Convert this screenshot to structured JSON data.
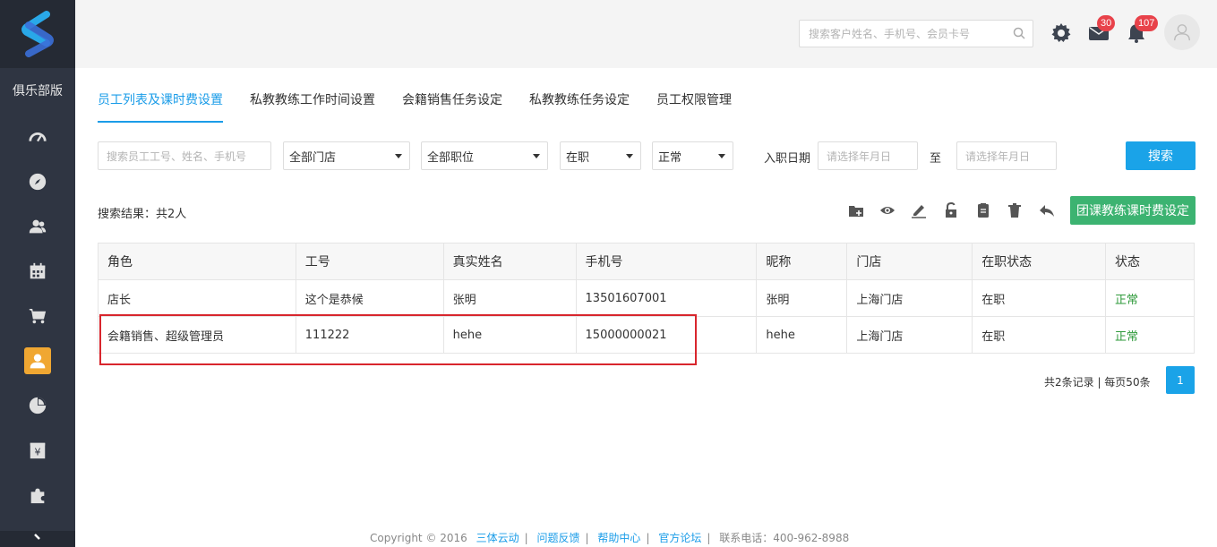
{
  "sidebar": {
    "edition_label": "俱乐部版",
    "icons": [
      "gauge-icon",
      "compass-icon",
      "users-icon",
      "calendar-icon",
      "cart-icon",
      "user-icon",
      "pie-chart-icon",
      "finance-icon",
      "puzzle-icon"
    ],
    "active_index": 5
  },
  "header": {
    "search_placeholder": "搜索客户姓名、手机号、会员卡号",
    "mail_count": "30",
    "notification_count": "107"
  },
  "tabs": [
    {
      "label": "员工列表及课时费设置",
      "active": true
    },
    {
      "label": "私教教练工作时间设置",
      "active": false
    },
    {
      "label": "会籍销售任务设定",
      "active": false
    },
    {
      "label": "私教教练任务设定",
      "active": false
    },
    {
      "label": "员工权限管理",
      "active": false
    }
  ],
  "filters": {
    "keyword_placeholder": "搜索员工工号、姓名、手机号",
    "store_select": "全部门店",
    "position_select": "全部职位",
    "employment_select": "在职",
    "status_select": "正常",
    "hire_date_label": "入职日期",
    "date_from_placeholder": "请选择年月日",
    "to_label": "至",
    "date_to_placeholder": "请选择年月日",
    "search_button": "搜索"
  },
  "toolbar": {
    "result_text": "搜索结果：共2人",
    "group_fee_button": "团课教练课时费设定"
  },
  "table": {
    "columns": [
      "角色",
      "工号",
      "真实姓名",
      "手机号",
      "昵称",
      "门店",
      "在职状态",
      "状态"
    ],
    "rows": [
      [
        "店长",
        "这个是恭候",
        "张明",
        "13501607001",
        "张明",
        "上海门店",
        "在职",
        "正常"
      ],
      [
        "会籍销售、超级管理员",
        "111222",
        "hehe",
        "15000000021",
        "hehe",
        "上海门店",
        "在职",
        "正常"
      ]
    ]
  },
  "pagination": {
    "summary": "共2条记录 | 每页50条",
    "current_page": "1"
  },
  "footer": {
    "copyright": "Copyright © 2016",
    "links": [
      "三体云动",
      "问题反馈",
      "帮助中心",
      "官方论坛"
    ],
    "phone": "联系电话：400-962-8988"
  },
  "colors": {
    "sidebar_bg": "#2f3542",
    "accent_blue": "#1a9ce8",
    "accent_green": "#3cb371",
    "active_orange": "#f0a732",
    "badge_red": "#e8424a",
    "highlight_red": "#d8262d"
  }
}
